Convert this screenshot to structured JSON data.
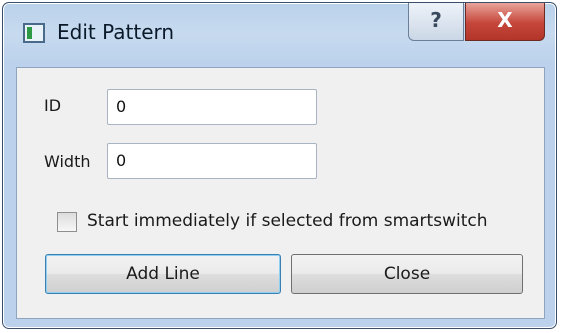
{
  "window": {
    "title": "Edit Pattern",
    "help_glyph": "?",
    "close_glyph": "X"
  },
  "form": {
    "id_label": "ID",
    "id_value": "0",
    "width_label": "Width",
    "width_value": "0",
    "checkbox_label": "Start immediately if selected from smartswitch",
    "checkbox_checked": false
  },
  "buttons": {
    "add_line": "Add Line",
    "close": "Close"
  },
  "icons": {
    "app": "window-app-icon",
    "help": "help-icon",
    "close": "close-icon"
  }
}
